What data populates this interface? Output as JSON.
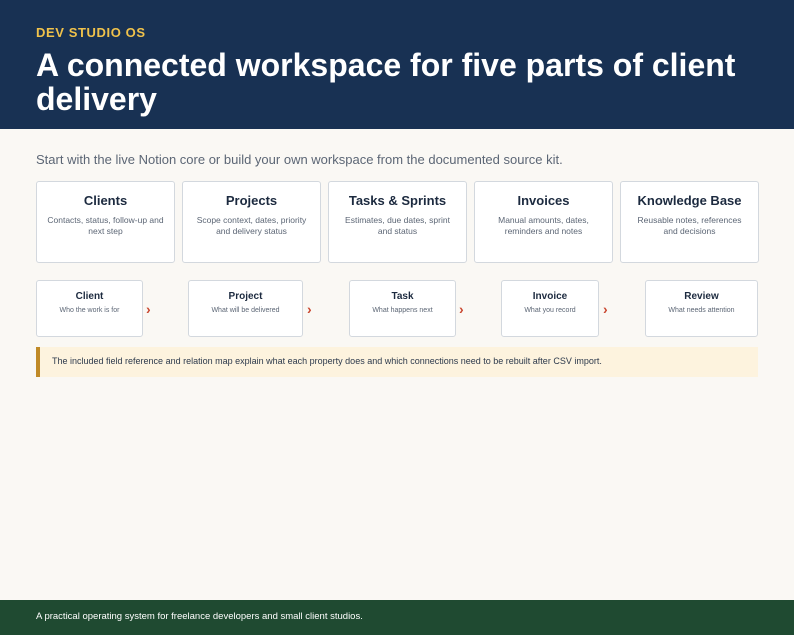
{
  "header": {
    "eyebrow": "DEV STUDIO OS",
    "title": "A connected workspace for five parts of client delivery"
  },
  "intro": "Start with the live Notion core or build your own workspace from the documented source kit.",
  "modules": [
    {
      "title": "Clients",
      "desc": "Contacts, status, follow-up and next step"
    },
    {
      "title": "Projects",
      "desc": "Scope context, dates, priority and delivery status"
    },
    {
      "title": "Tasks & Sprints",
      "desc": "Estimates, due dates, sprint and status"
    },
    {
      "title": "Invoices",
      "desc": "Manual amounts, dates, reminders and notes"
    },
    {
      "title": "Knowledge Base",
      "desc": "Reusable notes, references and decisions"
    }
  ],
  "flow": {
    "arrow_glyph": "›",
    "steps": [
      {
        "label": "Client",
        "sub": "Who the work is for"
      },
      {
        "label": "Project",
        "sub": "What will be delivered"
      },
      {
        "label": "Task",
        "sub": "What happens next"
      },
      {
        "label": "Invoice",
        "sub": "What you record"
      },
      {
        "label": "Review",
        "sub": "What needs attention"
      }
    ]
  },
  "note": "The included field reference and relation map explain what each property does and which connections need to be rebuilt after CSV import.",
  "footer": "A practical operating system for freelance developers and small client studios.",
  "colors": {
    "header_bg": "#183153",
    "eyebrow": "#f0c24b",
    "arrow": "#c9462f",
    "note_bg": "#fdf3de",
    "note_border": "#c08a27",
    "footer_bg": "#1f4a31"
  }
}
